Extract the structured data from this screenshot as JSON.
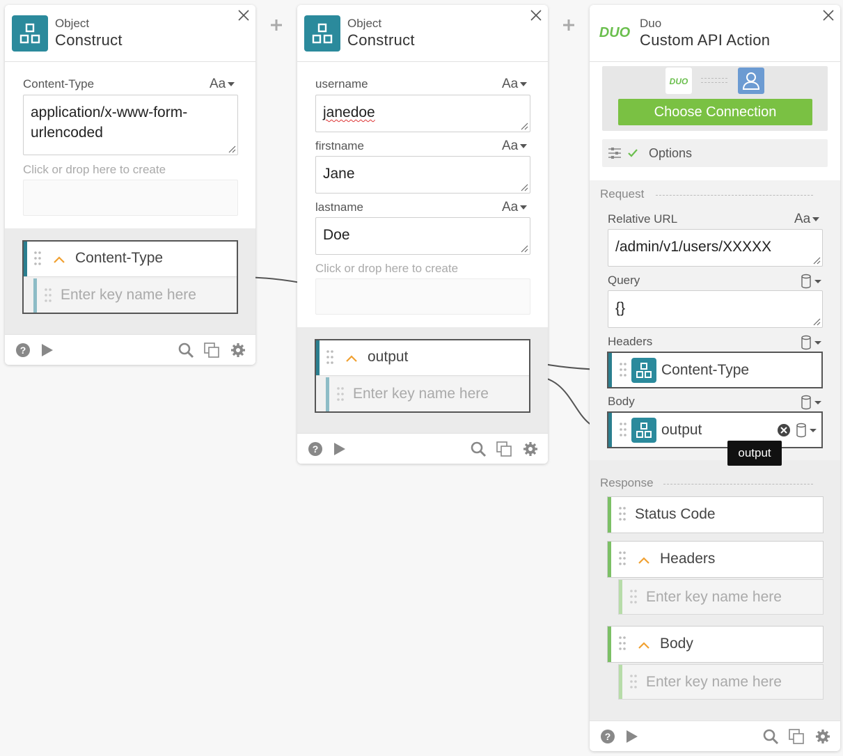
{
  "card1": {
    "subtitle": "Object",
    "title": "Construct",
    "field": {
      "label": "Content-Type",
      "type_toggle": "Aa",
      "value_line1": "application/x-www-form-",
      "value_line2": "urlencoded"
    },
    "drop_label": "Click or drop here to create",
    "node": {
      "label": "Content-Type",
      "key_placeholder": "Enter key name here"
    }
  },
  "card2": {
    "subtitle": "Object",
    "title": "Construct",
    "fields": [
      {
        "label": "username",
        "type_toggle": "Aa",
        "value": "janedoe"
      },
      {
        "label": "firstname",
        "type_toggle": "Aa",
        "value": "Jane"
      },
      {
        "label": "lastname",
        "type_toggle": "Aa",
        "value": "Doe"
      }
    ],
    "drop_label": "Click or drop here to create",
    "node": {
      "label": "output",
      "key_placeholder": "Enter key name here"
    }
  },
  "card3": {
    "subtitle": "Duo",
    "title": "Custom API Action",
    "logo_text": "DUO",
    "choose_connection": "Choose Connection",
    "options_label": "Options",
    "request_label": "Request",
    "relative_url": {
      "label": "Relative URL",
      "type_toggle": "Aa",
      "value": "/admin/v1/users/XXXXX"
    },
    "query": {
      "label": "Query",
      "value": "{}"
    },
    "headers": {
      "label": "Headers",
      "node_label": "Content-Type"
    },
    "body": {
      "label": "Body",
      "node_label": "output"
    },
    "tooltip": "output",
    "response_label": "Response",
    "response_items": [
      {
        "label": "Status Code"
      },
      {
        "label": "Headers",
        "key_placeholder": "Enter key name here"
      },
      {
        "label": "Body",
        "key_placeholder": "Enter key name here"
      }
    ]
  },
  "colors": {
    "accent": "#2b8a9c",
    "green": "#7ac143",
    "duo_green": "#6bbf4e"
  }
}
